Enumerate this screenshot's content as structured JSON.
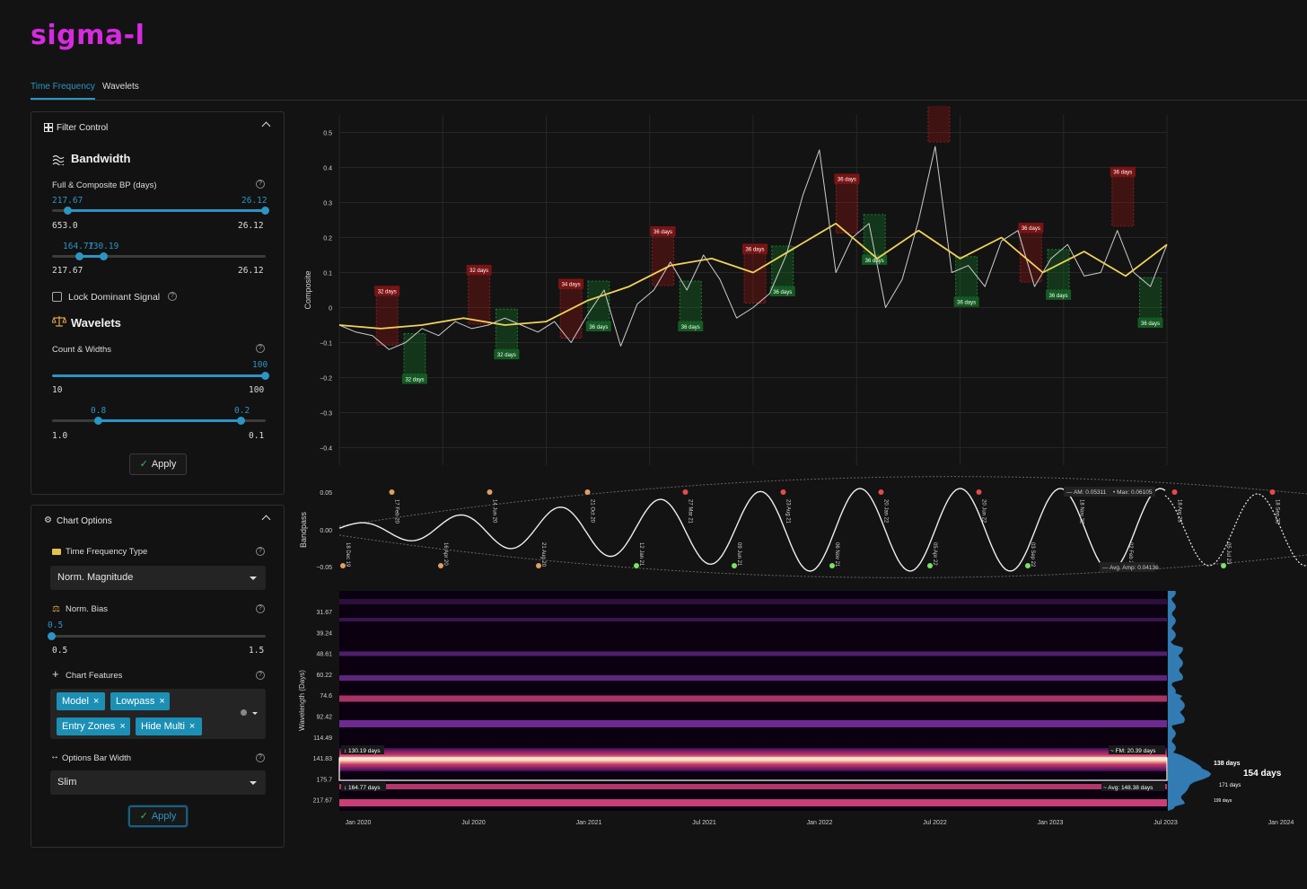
{
  "app": {
    "logo": "sigma-l"
  },
  "tabs": [
    {
      "label": "Time Frequency",
      "active": true
    },
    {
      "label": "Wavelets",
      "active": false
    }
  ],
  "filter_control": {
    "title": "Filter Control",
    "bandwidth": {
      "title": "Bandwidth",
      "label": "Full & Composite BP (days)",
      "slider1": {
        "value_left": "217.67",
        "value_right": "26.12",
        "min_label": "653.0",
        "max_label": "26.12",
        "low_fraction": 0.07,
        "high_fraction": 1.0
      },
      "slider2": {
        "value_left": "164.77",
        "value_right": "130.19",
        "min_label": "217.67",
        "max_label": "26.12",
        "low_fraction": 0.14,
        "high_fraction": 0.25
      }
    },
    "lock_dominant": {
      "label": "Lock Dominant Signal",
      "checked": false
    },
    "wavelets": {
      "title": "Wavelets",
      "label": "Count & Widths",
      "slider1": {
        "value": "100",
        "min_label": "10",
        "max_label": "100",
        "fraction": 1.0
      },
      "slider2": {
        "value_left": "0.8",
        "value_right": "0.2",
        "min_label": "1.0",
        "max_label": "0.1",
        "low_fraction": 0.22,
        "high_fraction": 0.89
      }
    },
    "apply_label": "Apply"
  },
  "chart_options": {
    "title": "Chart Options",
    "tf_type": {
      "label": "Time Frequency Type",
      "selected": "Norm. Magnitude"
    },
    "norm_bias": {
      "label": "Norm. Bias",
      "value": "0.5",
      "min_label": "0.5",
      "max_label": "1.5",
      "fraction": 0.0
    },
    "chart_features": {
      "label": "Chart Features",
      "chips": [
        "Model",
        "Lowpass",
        "Entry Zones",
        "Hide Multi"
      ]
    },
    "bar_width": {
      "label": "Options Bar Width",
      "selected": "Slim"
    },
    "apply_label": "Apply"
  },
  "chart_data": [
    {
      "type": "line",
      "ylabel": "Composite",
      "ylim": [
        -0.45,
        0.55
      ],
      "yticks": [
        "0.5",
        "0.4",
        "0.3",
        "0.2",
        "0.1",
        "0",
        "−0.1",
        "−0.2",
        "−0.3",
        "−0.4"
      ],
      "series": [
        {
          "color": "#cccccc",
          "x": [
            0,
            0.02,
            0.04,
            0.06,
            0.08,
            0.1,
            0.12,
            0.14,
            0.16,
            0.18,
            0.2,
            0.22,
            0.24,
            0.26,
            0.28,
            0.3,
            0.32,
            0.34,
            0.36,
            0.38,
            0.4,
            0.42,
            0.44,
            0.46,
            0.48,
            0.5,
            0.52,
            0.54,
            0.56,
            0.58,
            0.6,
            0.62,
            0.64,
            0.66,
            0.68,
            0.7,
            0.72,
            0.74,
            0.76,
            0.78,
            0.8,
            0.82,
            0.84,
            0.86,
            0.88,
            0.9,
            0.92,
            0.94,
            0.96,
            0.98,
            1.0
          ],
          "y": [
            -0.05,
            -0.07,
            -0.08,
            -0.12,
            -0.1,
            -0.06,
            -0.08,
            -0.04,
            -0.06,
            -0.05,
            -0.03,
            -0.05,
            -0.07,
            -0.04,
            -0.1,
            -0.02,
            0.05,
            -0.11,
            0.01,
            0.05,
            0.13,
            0.05,
            0.15,
            0.08,
            -0.03,
            0.0,
            0.04,
            0.15,
            0.32,
            0.45,
            0.1,
            0.2,
            0.24,
            0.0,
            0.08,
            0.25,
            0.46,
            0.1,
            0.12,
            0.06,
            0.19,
            0.22,
            0.06,
            0.14,
            0.18,
            0.09,
            0.1,
            0.22,
            0.1,
            0.06,
            0.18
          ]
        },
        {
          "color": "#f2d25b",
          "x": [
            0,
            0.05,
            0.1,
            0.15,
            0.2,
            0.25,
            0.3,
            0.35,
            0.4,
            0.45,
            0.5,
            0.55,
            0.6,
            0.65,
            0.7,
            0.75,
            0.8,
            0.85,
            0.9,
            0.95,
            1.0
          ],
          "y": [
            -0.05,
            -0.06,
            -0.05,
            -0.03,
            -0.05,
            -0.04,
            0.02,
            0.06,
            0.12,
            0.14,
            0.1,
            0.17,
            0.24,
            0.14,
            0.22,
            0.14,
            0.2,
            0.1,
            0.16,
            0.09,
            0.18
          ]
        }
      ],
      "markers_top": [
        "32 days",
        "32 days",
        "34 days",
        "36 days",
        "36 days",
        "36 days",
        "36 days",
        "36 days",
        "36 days"
      ],
      "markers_bottom": [
        "32 days",
        "32 days",
        "36 days",
        "36 days",
        "36 days",
        "36 days",
        "36 days",
        "36 days",
        "36 days"
      ]
    },
    {
      "type": "line",
      "ylabel": "Bandpass",
      "yticks": [
        "0.05",
        "0.00",
        "−0.05"
      ],
      "annotations": {
        "am": "AM: 0.05311",
        "max": "Max: 0.06105",
        "avg_amp": "Avg. Amp: 0.04136"
      },
      "dates": [
        "18 Dec 19",
        "17 Feb 20",
        "16 Apr 20",
        "14 Jun 20",
        "21 Aug 20",
        "21 Oct 20",
        "12 Jan 21",
        "27 Mar 21",
        "09 Jun 21",
        "23 Aug 21",
        "06 Nov 21",
        "20 Jan 22",
        "05 Apr 22",
        "20 Jun 22",
        "03 Sep 22",
        "18 Nov 22",
        "02 Feb 23",
        "18 Apr 23",
        "05 Jul 23",
        "18 Sep 23",
        "03 Dec 23"
      ]
    },
    {
      "type": "heatmap",
      "ylabel": "Wavelength (Days)",
      "yticks": [
        "31.67",
        "39.24",
        "48.61",
        "60.22",
        "74.6",
        "92.42",
        "114.49",
        "141.83",
        "175.7",
        "217.67"
      ],
      "xticks": [
        "Jan 2020",
        "Jul 2020",
        "Jan 2021",
        "Jul 2021",
        "Jan 2022",
        "Jul 2022",
        "Jan 2023",
        "Jul 2023",
        "Jan 2024"
      ],
      "annotations": {
        "band_top": "130.19 days",
        "band_bottom": "164.77 days",
        "fm": "FM: 20.39 days",
        "avg": "Avg: 148.38 days"
      },
      "side_labels": [
        "138 days",
        "154 days",
        "171 days",
        "199 days"
      ]
    }
  ]
}
